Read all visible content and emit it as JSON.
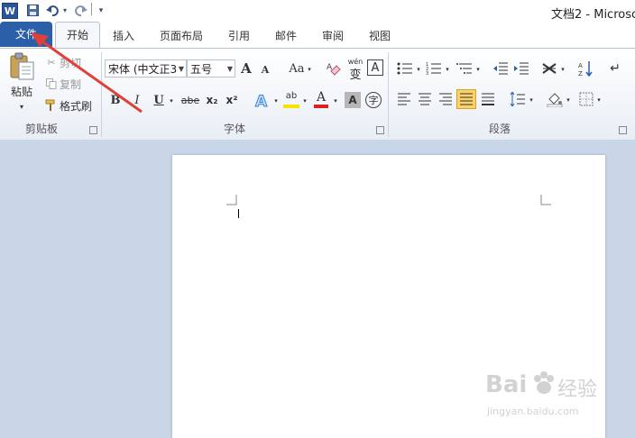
{
  "window": {
    "title": "文档2 - Microsc",
    "app_icon": "W"
  },
  "quick_access": {
    "save_icon": "save-icon",
    "undo_icon": "undo-icon",
    "redo_icon": "redo-icon",
    "customize_icon": "customize-icon"
  },
  "tabs": {
    "file": "文件",
    "home": "开始",
    "insert": "插入",
    "layout": "页面布局",
    "references": "引用",
    "mailings": "邮件",
    "review": "审阅",
    "view": "视图"
  },
  "clipboard": {
    "paste": "粘贴",
    "cut": "剪切",
    "copy": "复制",
    "format_painter": "格式刷",
    "group_label": "剪贴板"
  },
  "font": {
    "font_name": "宋体 (中文正3",
    "font_size": "五号",
    "grow": "A",
    "shrink": "A",
    "change_case": "Aa",
    "bold": "B",
    "italic": "I",
    "underline": "U",
    "strikethrough": "abe",
    "subscript": "x₂",
    "superscript": "x²",
    "highlight_letters": "ab",
    "font_color_letter": "A",
    "char_shading_letter": "A",
    "enclose_char": "字",
    "pinyin_char": "变",
    "pinyin_top": "wén",
    "group_label": "字体"
  },
  "paragraph": {
    "group_label": "段落"
  },
  "watermark": {
    "line1": "Bai",
    "line2": "经验",
    "url": "jingyan.baidu.com"
  },
  "colors": {
    "file_tab": "#2b5fa8",
    "font_color_bar": "#e0201c",
    "highlight_bar": "#f4e400",
    "arrow": "#e0403a"
  }
}
